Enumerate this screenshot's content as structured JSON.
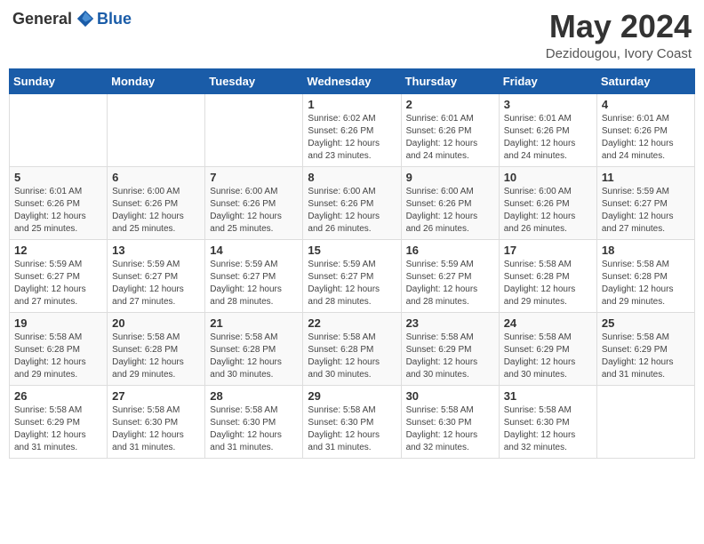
{
  "logo": {
    "general": "General",
    "blue": "Blue"
  },
  "header": {
    "month": "May 2024",
    "location": "Dezidougou, Ivory Coast"
  },
  "weekdays": [
    "Sunday",
    "Monday",
    "Tuesday",
    "Wednesday",
    "Thursday",
    "Friday",
    "Saturday"
  ],
  "weeks": [
    [
      {
        "day": "",
        "info": ""
      },
      {
        "day": "",
        "info": ""
      },
      {
        "day": "",
        "info": ""
      },
      {
        "day": "1",
        "info": "Sunrise: 6:02 AM\nSunset: 6:26 PM\nDaylight: 12 hours\nand 23 minutes."
      },
      {
        "day": "2",
        "info": "Sunrise: 6:01 AM\nSunset: 6:26 PM\nDaylight: 12 hours\nand 24 minutes."
      },
      {
        "day": "3",
        "info": "Sunrise: 6:01 AM\nSunset: 6:26 PM\nDaylight: 12 hours\nand 24 minutes."
      },
      {
        "day": "4",
        "info": "Sunrise: 6:01 AM\nSunset: 6:26 PM\nDaylight: 12 hours\nand 24 minutes."
      }
    ],
    [
      {
        "day": "5",
        "info": "Sunrise: 6:01 AM\nSunset: 6:26 PM\nDaylight: 12 hours\nand 25 minutes."
      },
      {
        "day": "6",
        "info": "Sunrise: 6:00 AM\nSunset: 6:26 PM\nDaylight: 12 hours\nand 25 minutes."
      },
      {
        "day": "7",
        "info": "Sunrise: 6:00 AM\nSunset: 6:26 PM\nDaylight: 12 hours\nand 25 minutes."
      },
      {
        "day": "8",
        "info": "Sunrise: 6:00 AM\nSunset: 6:26 PM\nDaylight: 12 hours\nand 26 minutes."
      },
      {
        "day": "9",
        "info": "Sunrise: 6:00 AM\nSunset: 6:26 PM\nDaylight: 12 hours\nand 26 minutes."
      },
      {
        "day": "10",
        "info": "Sunrise: 6:00 AM\nSunset: 6:26 PM\nDaylight: 12 hours\nand 26 minutes."
      },
      {
        "day": "11",
        "info": "Sunrise: 5:59 AM\nSunset: 6:27 PM\nDaylight: 12 hours\nand 27 minutes."
      }
    ],
    [
      {
        "day": "12",
        "info": "Sunrise: 5:59 AM\nSunset: 6:27 PM\nDaylight: 12 hours\nand 27 minutes."
      },
      {
        "day": "13",
        "info": "Sunrise: 5:59 AM\nSunset: 6:27 PM\nDaylight: 12 hours\nand 27 minutes."
      },
      {
        "day": "14",
        "info": "Sunrise: 5:59 AM\nSunset: 6:27 PM\nDaylight: 12 hours\nand 28 minutes."
      },
      {
        "day": "15",
        "info": "Sunrise: 5:59 AM\nSunset: 6:27 PM\nDaylight: 12 hours\nand 28 minutes."
      },
      {
        "day": "16",
        "info": "Sunrise: 5:59 AM\nSunset: 6:27 PM\nDaylight: 12 hours\nand 28 minutes."
      },
      {
        "day": "17",
        "info": "Sunrise: 5:58 AM\nSunset: 6:28 PM\nDaylight: 12 hours\nand 29 minutes."
      },
      {
        "day": "18",
        "info": "Sunrise: 5:58 AM\nSunset: 6:28 PM\nDaylight: 12 hours\nand 29 minutes."
      }
    ],
    [
      {
        "day": "19",
        "info": "Sunrise: 5:58 AM\nSunset: 6:28 PM\nDaylight: 12 hours\nand 29 minutes."
      },
      {
        "day": "20",
        "info": "Sunrise: 5:58 AM\nSunset: 6:28 PM\nDaylight: 12 hours\nand 29 minutes."
      },
      {
        "day": "21",
        "info": "Sunrise: 5:58 AM\nSunset: 6:28 PM\nDaylight: 12 hours\nand 30 minutes."
      },
      {
        "day": "22",
        "info": "Sunrise: 5:58 AM\nSunset: 6:28 PM\nDaylight: 12 hours\nand 30 minutes."
      },
      {
        "day": "23",
        "info": "Sunrise: 5:58 AM\nSunset: 6:29 PM\nDaylight: 12 hours\nand 30 minutes."
      },
      {
        "day": "24",
        "info": "Sunrise: 5:58 AM\nSunset: 6:29 PM\nDaylight: 12 hours\nand 30 minutes."
      },
      {
        "day": "25",
        "info": "Sunrise: 5:58 AM\nSunset: 6:29 PM\nDaylight: 12 hours\nand 31 minutes."
      }
    ],
    [
      {
        "day": "26",
        "info": "Sunrise: 5:58 AM\nSunset: 6:29 PM\nDaylight: 12 hours\nand 31 minutes."
      },
      {
        "day": "27",
        "info": "Sunrise: 5:58 AM\nSunset: 6:30 PM\nDaylight: 12 hours\nand 31 minutes."
      },
      {
        "day": "28",
        "info": "Sunrise: 5:58 AM\nSunset: 6:30 PM\nDaylight: 12 hours\nand 31 minutes."
      },
      {
        "day": "29",
        "info": "Sunrise: 5:58 AM\nSunset: 6:30 PM\nDaylight: 12 hours\nand 31 minutes."
      },
      {
        "day": "30",
        "info": "Sunrise: 5:58 AM\nSunset: 6:30 PM\nDaylight: 12 hours\nand 32 minutes."
      },
      {
        "day": "31",
        "info": "Sunrise: 5:58 AM\nSunset: 6:30 PM\nDaylight: 12 hours\nand 32 minutes."
      },
      {
        "day": "",
        "info": ""
      }
    ]
  ]
}
